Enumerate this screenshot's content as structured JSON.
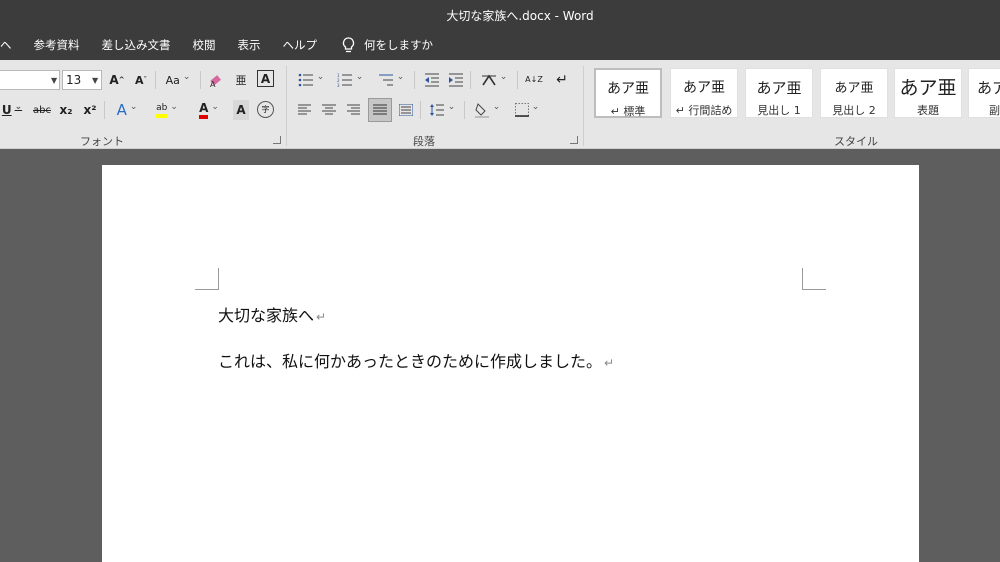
{
  "window": {
    "title": "大切な家族へ.docx  -  Word"
  },
  "tabs": [
    {
      "label": "ヘ"
    },
    {
      "label": "参考資料"
    },
    {
      "label": "差し込み文書"
    },
    {
      "label": "校閲"
    },
    {
      "label": "表示"
    },
    {
      "label": "ヘルプ"
    }
  ],
  "tell_me": {
    "label": "何をしますか"
  },
  "font_group": {
    "font_size": "13",
    "grow_font": "A",
    "shrink_font": "A",
    "change_case": "Aa",
    "phonetic_guide": "亜",
    "char_border": "A",
    "underline": "U",
    "strikethrough": "abc",
    "subscript": "x₂",
    "superscript": "x²",
    "text_effects": "A",
    "highlight": "ab",
    "font_color": "A",
    "char_shading": "A",
    "enclose_char": "字",
    "label": "フォント"
  },
  "paragraph_group": {
    "sort": "A↓Z",
    "label": "段落"
  },
  "styles_group": {
    "label": "スタイル",
    "items": [
      {
        "sample": "あア亜",
        "name": "↵ 標準"
      },
      {
        "sample": "あア亜",
        "name": "↵ 行間詰め"
      },
      {
        "sample": "あア亜",
        "name": "見出し 1"
      },
      {
        "sample": "あア亜",
        "name": "見出し 2"
      },
      {
        "sample": "あア亜",
        "name": "表題"
      },
      {
        "sample": "あア",
        "name": "副"
      }
    ]
  },
  "document": {
    "paragraphs": [
      {
        "text": "大切な家族へ"
      },
      {
        "text": "これは、私に何かあったときのために作成しました。"
      }
    ],
    "paragraph_mark": "↵"
  },
  "colors": {
    "titlebar": "#3c3c3c",
    "ribbon": "#e6e6e6",
    "workspace": "#5e5e5e",
    "highlight_yellow": "#ffff00",
    "font_red": "#e00000",
    "accent_blue": "#2b579a"
  }
}
